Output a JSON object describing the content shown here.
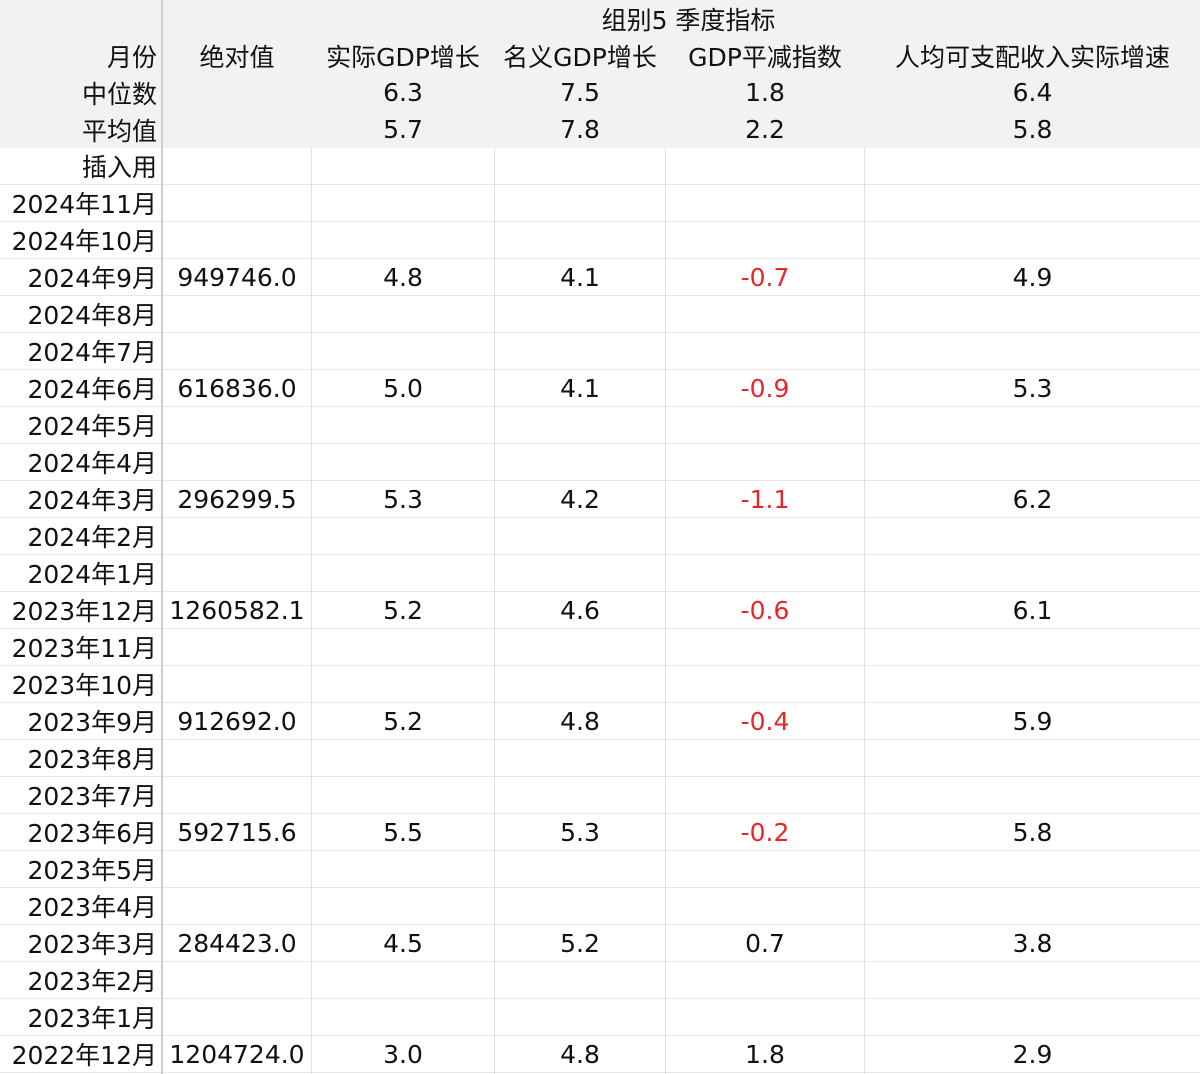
{
  "header": {
    "group_title": "组别5 季度指标",
    "columns": [
      "月份",
      "绝对值",
      "实际GDP增长",
      "名义GDP增长",
      "GDP平减指数",
      "人均可支配收入实际增速"
    ],
    "stats": [
      {
        "label": "中位数",
        "values": [
          "",
          "6.3",
          "7.5",
          "1.8",
          "6.4"
        ]
      },
      {
        "label": "平均值",
        "values": [
          "",
          "5.7",
          "7.8",
          "2.2",
          "5.8"
        ]
      }
    ]
  },
  "rows": [
    [
      "插入用",
      "",
      "",
      "",
      "",
      ""
    ],
    [
      "2024年11月",
      "",
      "",
      "",
      "",
      ""
    ],
    [
      "2024年10月",
      "",
      "",
      "",
      "",
      ""
    ],
    [
      "2024年9月",
      "949746.0",
      "4.8",
      "4.1",
      "-0.7",
      "4.9"
    ],
    [
      "2024年8月",
      "",
      "",
      "",
      "",
      ""
    ],
    [
      "2024年7月",
      "",
      "",
      "",
      "",
      ""
    ],
    [
      "2024年6月",
      "616836.0",
      "5.0",
      "4.1",
      "-0.9",
      "5.3"
    ],
    [
      "2024年5月",
      "",
      "",
      "",
      "",
      ""
    ],
    [
      "2024年4月",
      "",
      "",
      "",
      "",
      ""
    ],
    [
      "2024年3月",
      "296299.5",
      "5.3",
      "4.2",
      "-1.1",
      "6.2"
    ],
    [
      "2024年2月",
      "",
      "",
      "",
      "",
      ""
    ],
    [
      "2024年1月",
      "",
      "",
      "",
      "",
      ""
    ],
    [
      "2023年12月",
      "1260582.1",
      "5.2",
      "4.6",
      "-0.6",
      "6.1"
    ],
    [
      "2023年11月",
      "",
      "",
      "",
      "",
      ""
    ],
    [
      "2023年10月",
      "",
      "",
      "",
      "",
      ""
    ],
    [
      "2023年9月",
      "912692.0",
      "5.2",
      "4.8",
      "-0.4",
      "5.9"
    ],
    [
      "2023年8月",
      "",
      "",
      "",
      "",
      ""
    ],
    [
      "2023年7月",
      "",
      "",
      "",
      "",
      ""
    ],
    [
      "2023年6月",
      "592715.6",
      "5.5",
      "5.3",
      "-0.2",
      "5.8"
    ],
    [
      "2023年5月",
      "",
      "",
      "",
      "",
      ""
    ],
    [
      "2023年4月",
      "",
      "",
      "",
      "",
      ""
    ],
    [
      "2023年3月",
      "284423.0",
      "4.5",
      "5.2",
      "0.7",
      "3.8"
    ],
    [
      "2023年2月",
      "",
      "",
      "",
      "",
      ""
    ],
    [
      "2023年1月",
      "",
      "",
      "",
      "",
      ""
    ],
    [
      "2022年12月",
      "1204724.0",
      "3.0",
      "4.8",
      "1.8",
      "2.9"
    ]
  ],
  "colors": {
    "negative": "#e8262a",
    "header_bg": "#f2f2f2",
    "grid": "#e6e6e6"
  }
}
